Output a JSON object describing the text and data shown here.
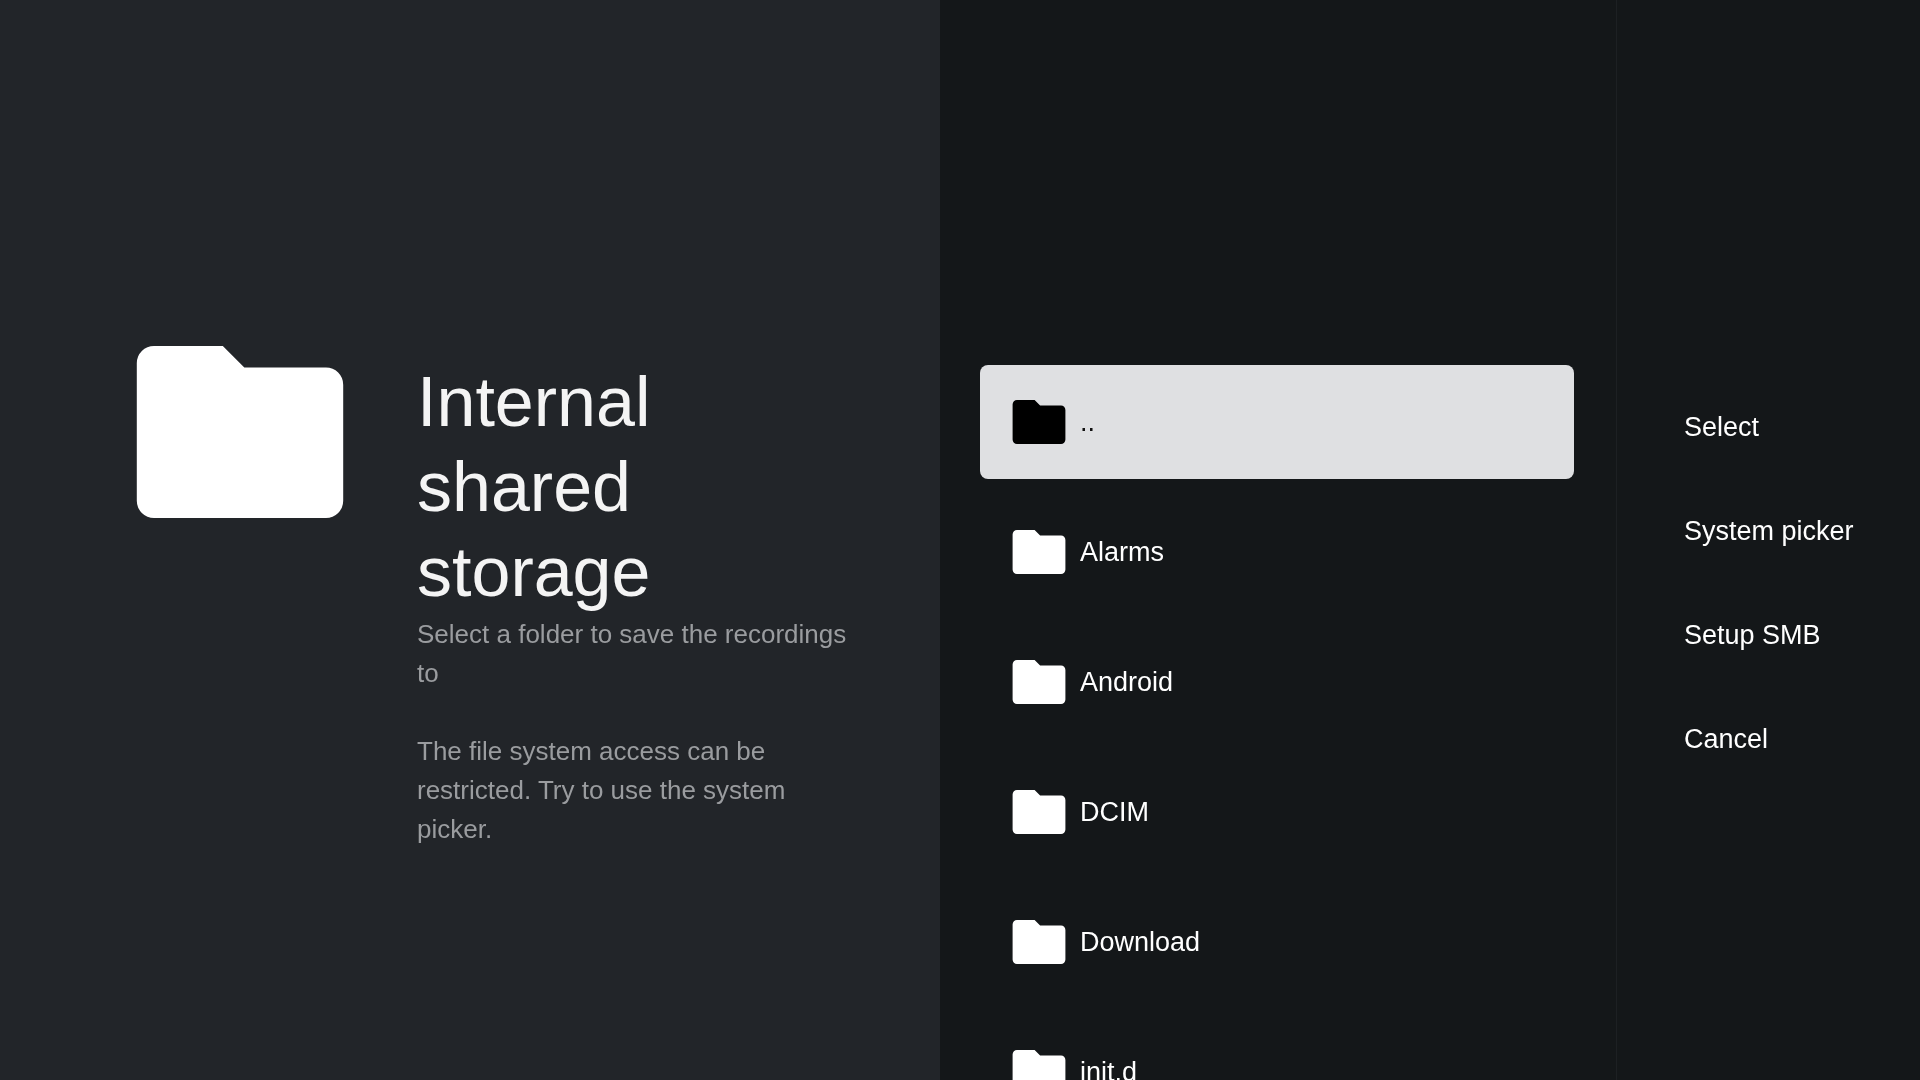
{
  "info": {
    "title": "Internal shared storage",
    "description": "Select a folder to save the recordings to",
    "note": "The file system access can be restricted. Try to use the system picker."
  },
  "folders": [
    {
      "name": "..",
      "selected": true
    },
    {
      "name": "Alarms",
      "selected": false
    },
    {
      "name": "Android",
      "selected": false
    },
    {
      "name": "DCIM",
      "selected": false
    },
    {
      "name": "Download",
      "selected": false
    },
    {
      "name": "init.d",
      "selected": false
    }
  ],
  "actions": [
    {
      "label": "Select"
    },
    {
      "label": "System picker"
    },
    {
      "label": "Setup SMB"
    },
    {
      "label": "Cancel"
    }
  ]
}
